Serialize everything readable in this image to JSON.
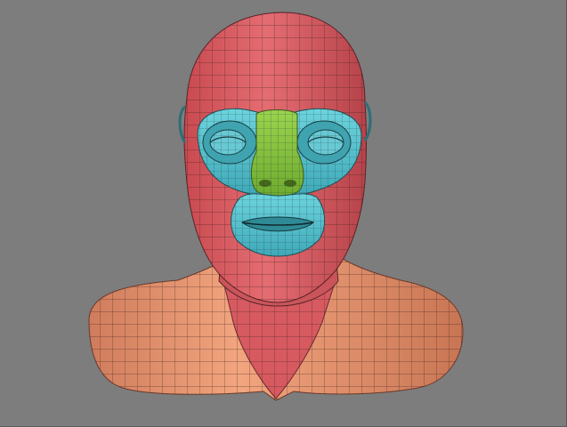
{
  "viewport": {
    "title": "",
    "background": "#7d7d7d"
  },
  "model": {
    "name": "",
    "polygroups": [
      {
        "id": "head",
        "color": "#d9595f"
      },
      {
        "id": "eye-region",
        "color": "#4fbdca"
      },
      {
        "id": "nose",
        "color": "#8cc63e"
      },
      {
        "id": "mouth-region",
        "color": "#4fbdca"
      },
      {
        "id": "shoulders",
        "color": "#e8966e"
      },
      {
        "id": "chest-v",
        "color": "#d9595f"
      }
    ],
    "wire_color": "#3a2020",
    "wireframe": true
  }
}
